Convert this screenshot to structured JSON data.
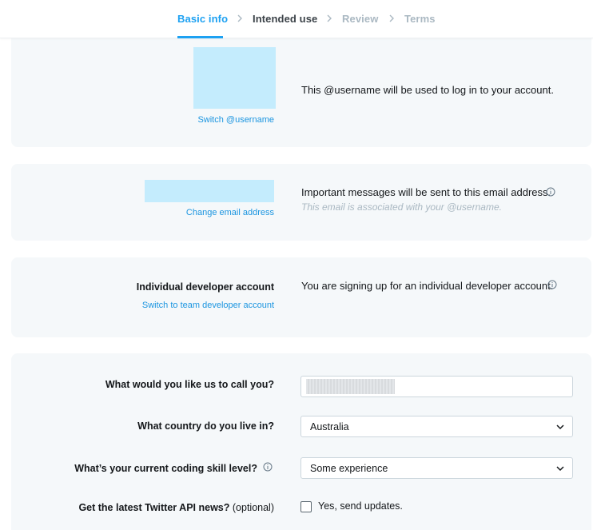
{
  "stepper": {
    "steps": [
      {
        "label": "Basic info",
        "state": "active"
      },
      {
        "label": "Intended use",
        "state": "done"
      },
      {
        "label": "Review",
        "state": "todo"
      },
      {
        "label": "Terms",
        "state": "todo"
      }
    ]
  },
  "username_section": {
    "switch_link": "Switch @username",
    "message": "This @username will be used to log in to your account."
  },
  "email_section": {
    "change_link": "Change email address",
    "message": "Important messages will be sent to this email address.",
    "sub_message": "This email is associated with your @username.",
    "info_icon": "info-icon"
  },
  "account_section": {
    "title": "Individual developer account",
    "switch_link": "Switch to team developer account",
    "message": "You are signing up for an individual developer account.",
    "info_icon": "info-icon"
  },
  "form": {
    "name_label": "What would you like us to call you?",
    "name_value": "",
    "country_label": "What country do you live in?",
    "country_value": "Australia",
    "skill_label": "What’s your current coding skill level?",
    "skill_value": "Some experience",
    "news_label": "Get the latest Twitter API news?",
    "news_optional": "(optional)",
    "news_checkbox_label": "Yes, send updates.",
    "news_checked": false
  },
  "colors": {
    "accent": "#1da1f2",
    "link": "#1b95e0",
    "card_bg": "#f5f8fa",
    "redacted": "#c4ecfd"
  }
}
